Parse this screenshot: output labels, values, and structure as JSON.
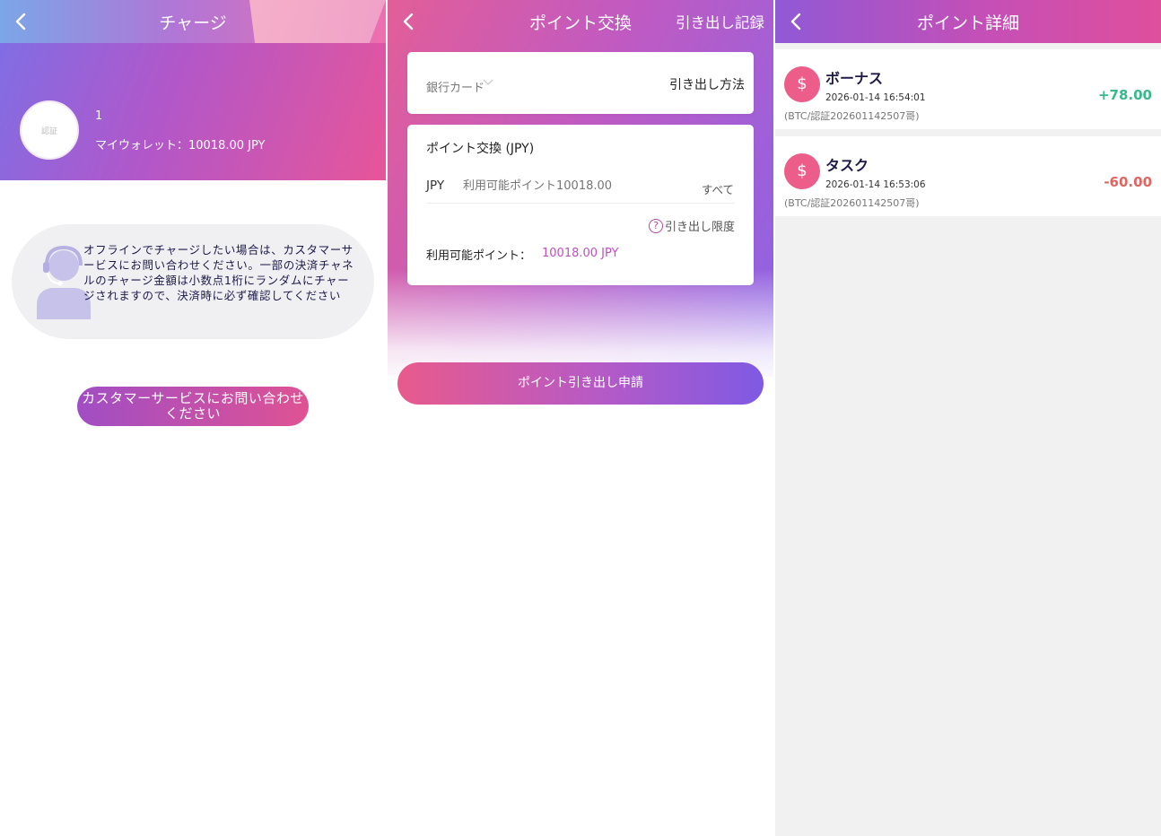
{
  "charge_screen": {
    "title": "チャージ",
    "avatar_text": "認証",
    "user_id": "1",
    "wallet_text": "マイウォレット：10018.00 JPY",
    "notice": "オフラインでチャージしたい場合は、カスタマーサービスにお問い合わせください。一部の決済チャネルのチャージ金額は小数点1桁にランダムにチャージされますので、決済時に必ず確認してください",
    "cs_button_label": "カスタマーサービスにお問い合わせください"
  },
  "exchange_screen": {
    "title": "ポイント交換",
    "history_link": "引き出し記録",
    "bank_card_placeholder": "銀行カード",
    "withdraw_method": "引き出し方法",
    "section_title": "ポイント交換 (JPY)",
    "currency": "JPY",
    "amount_placeholder": "利用可能ポイント10018.00",
    "all_label": "すべて",
    "limit_label": "引き出し限度",
    "available_label": "利用可能ポイント：",
    "available_value": "10018.00 JPY",
    "submit_label": "ポイント引き出し申請"
  },
  "detail_screen": {
    "title": "ポイント詳細",
    "records": [
      {
        "icon": "$",
        "title": "ボーナス",
        "time": "2026-01-14 16:54:01",
        "ref": "(BTC/認証202601142507哥)",
        "amount": "+78.00"
      },
      {
        "icon": "$",
        "title": "タスク",
        "time": "2026-01-14 16:53:06",
        "ref": "(BTC/認証202601142507哥)",
        "amount": "-60.00"
      }
    ]
  },
  "colors": {
    "positive": "#3ab88a",
    "negative": "#e0645f",
    "accent": "#c04fbf"
  }
}
